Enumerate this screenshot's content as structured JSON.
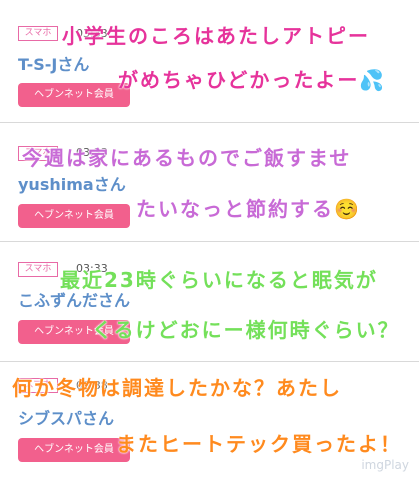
{
  "rows": [
    {
      "tag": "スマホ",
      "time": "03:33",
      "name": "T-S-Jさん",
      "badge": "ヘブンネット会員"
    },
    {
      "tag": "スマホ",
      "time": "03:33",
      "name": "yushimaさん",
      "badge": "ヘブンネット会員"
    },
    {
      "tag": "スマホ",
      "time": "03:33",
      "name": "こふずんださん",
      "badge": "ヘブンネット会員"
    },
    {
      "tag": "スマホ",
      "time": "03:38",
      "name": "シブスパさん",
      "badge": "ヘブンネット会員"
    }
  ],
  "handwriting": [
    {
      "text": "小学生のころはあたしアトピー"
    },
    {
      "text": "がめちゃひどかったよー"
    },
    {
      "text": "今週は家にあるものでご飯すませ"
    },
    {
      "text": "たいなっと節約する"
    },
    {
      "text": "最近23時ぐらいになると眠気が"
    },
    {
      "text": "くるけどおにー様何時ぐらい？"
    },
    {
      "text": "何か冬物は調達したかな？あたし"
    },
    {
      "text": "またヒートテック買ったよ！"
    }
  ],
  "emoji": {
    "sweat": "💦",
    "smile": "☺️"
  },
  "watermark": "imgPlay"
}
